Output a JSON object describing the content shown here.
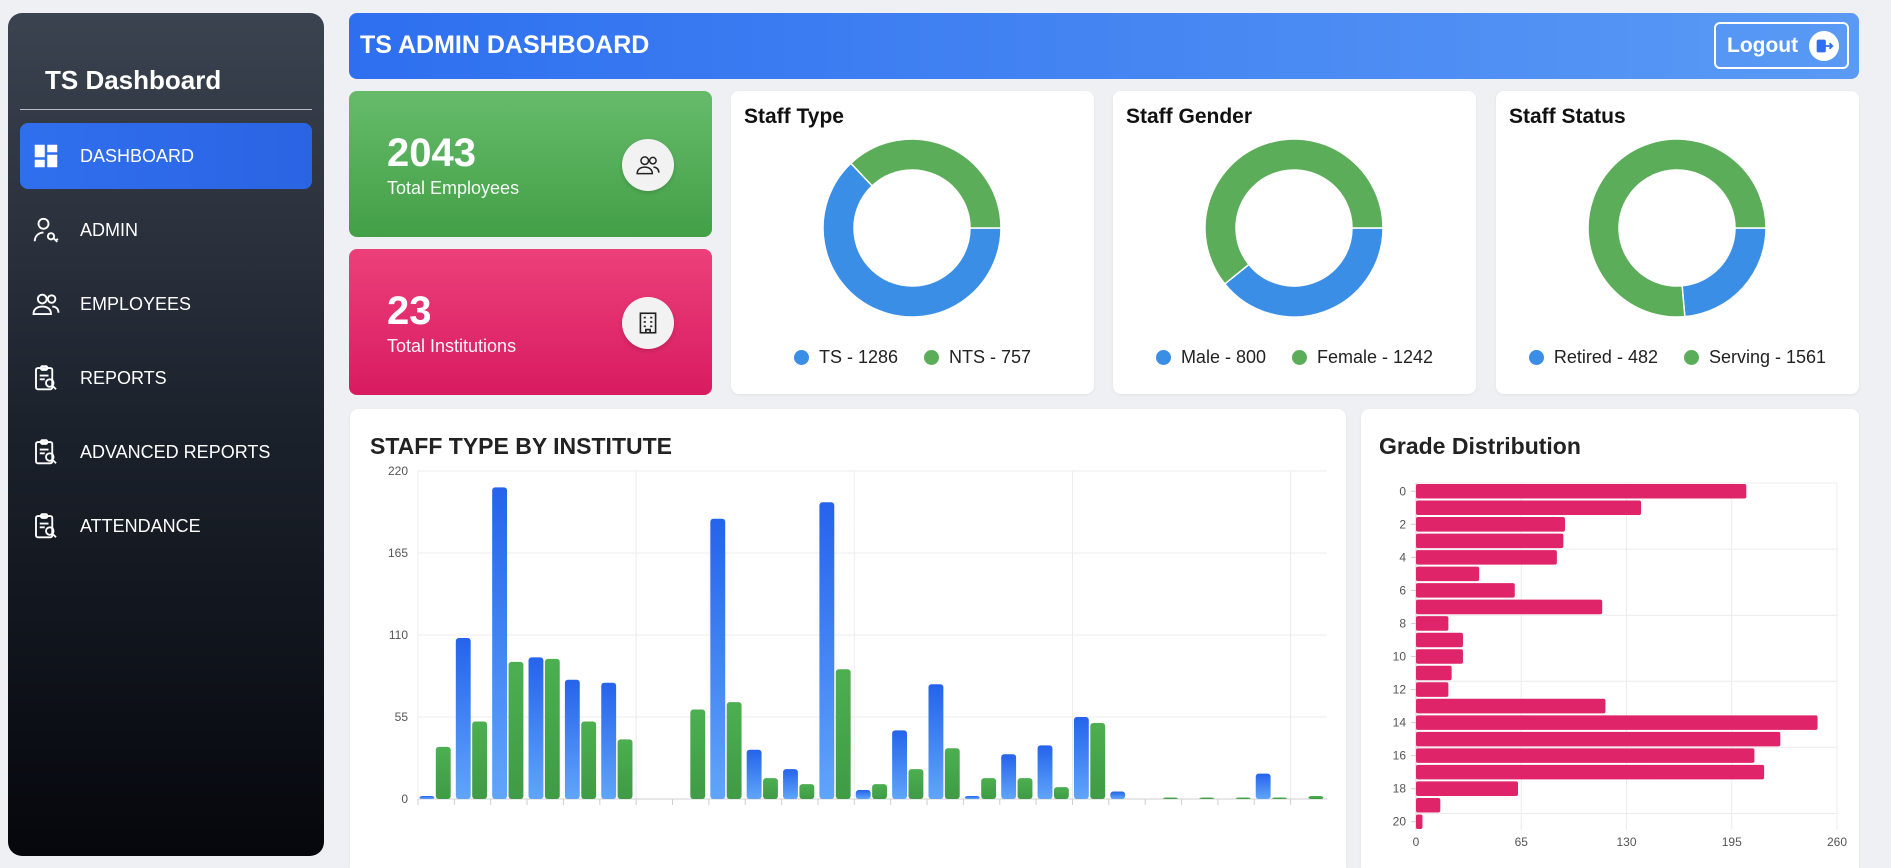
{
  "sidebar": {
    "brand": "TS Dashboard",
    "items": [
      {
        "label": "DASHBOARD",
        "icon": "dashboard-icon",
        "active": true
      },
      {
        "label": "ADMIN",
        "icon": "admin-user-key-icon",
        "active": false
      },
      {
        "label": "EMPLOYEES",
        "icon": "users-icon",
        "active": false
      },
      {
        "label": "REPORTS",
        "icon": "clipboard-search-icon",
        "active": false
      },
      {
        "label": "ADVANCED REPORTS",
        "icon": "clipboard-search-icon",
        "active": false
      },
      {
        "label": "ATTENDANCE",
        "icon": "clipboard-search-icon",
        "active": false
      }
    ]
  },
  "header": {
    "title": "TS ADMIN DASHBOARD",
    "logout_label": "Logout"
  },
  "stats": {
    "employees": {
      "value": "2043",
      "label": "Total Employees"
    },
    "institutions": {
      "value": "23",
      "label": "Total Institutions"
    }
  },
  "colors": {
    "blue": "#3a8ee6",
    "green": "#5cad5a",
    "pink": "#e0246a",
    "header": "#2e6ff0"
  },
  "donuts": {
    "staff_type": {
      "title": "Staff Type",
      "legend": [
        "TS - 1286",
        "NTS - 757"
      ],
      "values": [
        1286,
        757
      ]
    },
    "staff_gender": {
      "title": "Staff Gender",
      "legend": [
        "Male - 800",
        "Female - 1242"
      ],
      "values": [
        800,
        1242
      ]
    },
    "staff_status": {
      "title": "Staff Status",
      "legend": [
        "Retired - 482",
        "Serving - 1561"
      ],
      "values": [
        482,
        1561
      ]
    }
  },
  "chart_data": [
    {
      "type": "bar",
      "title": "STAFF TYPE BY INSTITUTE",
      "ylim": [
        0,
        220
      ],
      "yticks": [
        "0",
        "55",
        "110",
        "165",
        "220"
      ],
      "grid": true,
      "series": [
        {
          "values": [
            2,
            108,
            209,
            95,
            80,
            78,
            0,
            0,
            188,
            33,
            20,
            199,
            6,
            46,
            77,
            2,
            30,
            36,
            55,
            5,
            0,
            0,
            0,
            17,
            0
          ]
        },
        {
          "values": [
            35,
            52,
            92,
            94,
            52,
            40,
            0,
            60,
            65,
            14,
            10,
            87,
            10,
            20,
            34,
            14,
            14,
            8,
            51,
            0,
            1,
            1,
            1,
            1,
            2
          ]
        }
      ]
    },
    {
      "type": "bar",
      "orientation": "horizontal",
      "title": "Grade Distribution",
      "categories": [
        "0",
        "1",
        "2",
        "3",
        "4",
        "5",
        "6",
        "7",
        "8",
        "9",
        "10",
        "11",
        "12",
        "13",
        "14",
        "15",
        "16",
        "17",
        "18",
        "19",
        "20"
      ],
      "ytick_labels": [
        "0",
        "2",
        "4",
        "6",
        "8",
        "10",
        "12",
        "14",
        "16",
        "18",
        "20"
      ],
      "xticks": [
        "0",
        "65",
        "130",
        "195",
        "260"
      ],
      "xlim": [
        0,
        260
      ],
      "grid": true,
      "values": [
        204,
        139,
        92,
        91,
        87,
        39,
        61,
        115,
        20,
        29,
        29,
        22,
        20,
        117,
        248,
        225,
        209,
        215,
        63,
        15,
        4
      ]
    }
  ]
}
